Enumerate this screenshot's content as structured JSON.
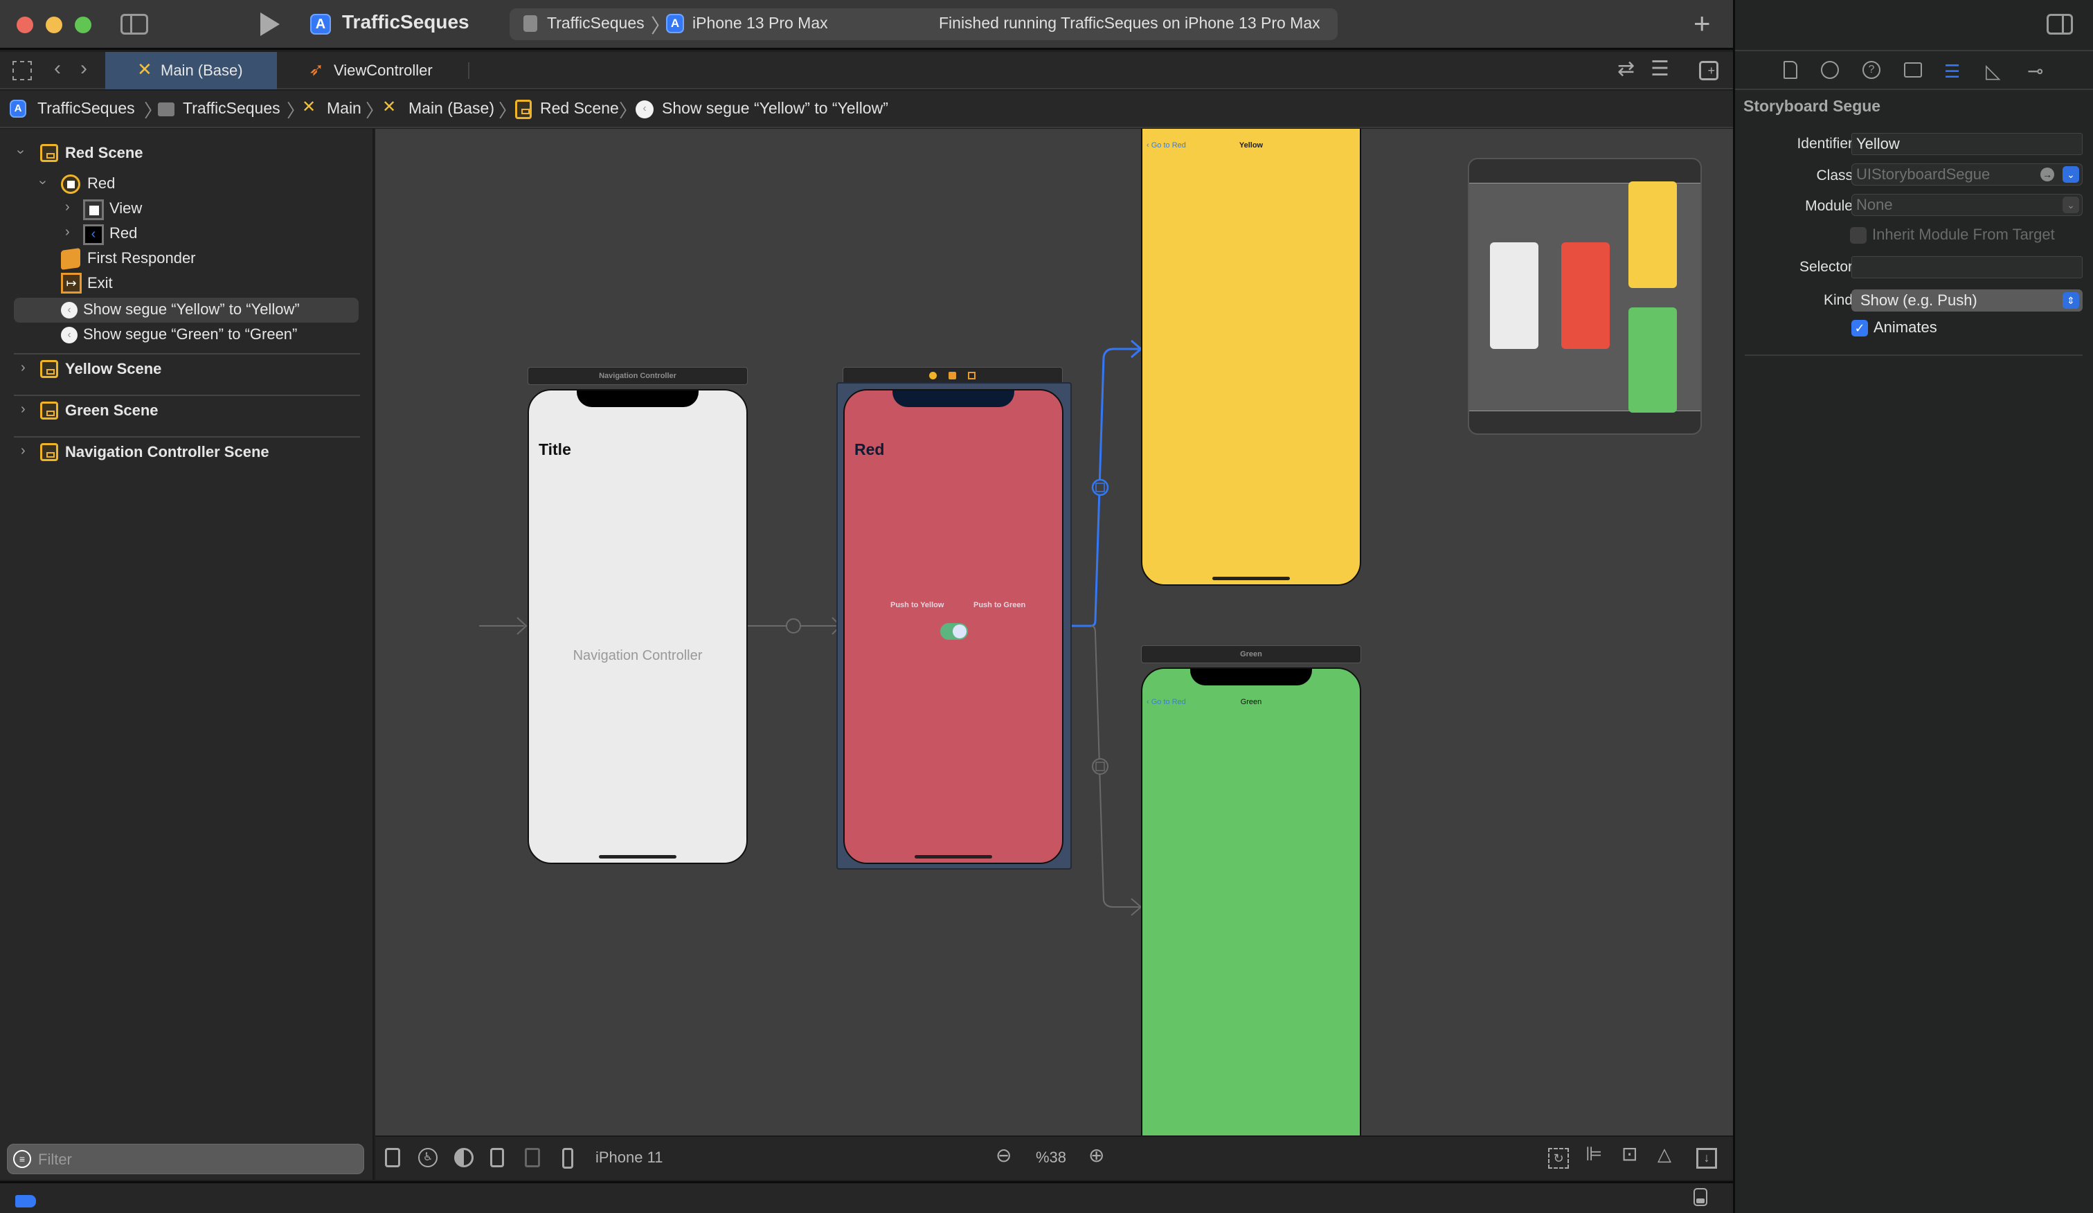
{
  "window": {
    "project_name": "TrafficSeques",
    "scheme": "TrafficSeques",
    "device": "iPhone 13 Pro Max",
    "status": "Finished running TrafficSeques on iPhone 13 Pro Max",
    "add_label": "+"
  },
  "tabs": [
    {
      "label": "Main (Base)",
      "active": true,
      "icon": "storyboard-icon"
    },
    {
      "label": "ViewController",
      "active": false,
      "icon": "swift-icon"
    }
  ],
  "breadcrumb": [
    {
      "label": "TrafficSeques",
      "icon": "app-icon"
    },
    {
      "label": "TrafficSeques",
      "icon": "folder-icon"
    },
    {
      "label": "Main",
      "icon": "storyboard-icon"
    },
    {
      "label": "Main (Base)",
      "icon": "storyboard-icon"
    },
    {
      "label": "Red Scene",
      "icon": "scene-icon"
    },
    {
      "label": "Show segue “Yellow” to “Yellow”",
      "icon": "segue-icon"
    }
  ],
  "navigator": {
    "red_scene": "Red Scene",
    "red_vc": "Red",
    "view": "View",
    "nav_item": "Red",
    "first_responder": "First Responder",
    "exit": "Exit",
    "segue_yellow": "Show segue “Yellow” to “Yellow”",
    "segue_green": "Show segue “Green” to “Green”",
    "yellow_scene": "Yellow Scene",
    "green_scene": "Green Scene",
    "nav_scene": "Navigation Controller Scene",
    "filter_placeholder": "Filter"
  },
  "canvas": {
    "nav_controller": {
      "bar_title": "Navigation Controller",
      "large_title": "Title",
      "center_label": "Navigation Controller",
      "color": "#ebebeb"
    },
    "red": {
      "large_title": "Red",
      "button_yellow": "Push to Yellow",
      "button_green": "Push to Green",
      "switch_on": true,
      "color": "#c75562"
    },
    "yellow": {
      "back_label": "Go to Red",
      "title": "Yellow",
      "color": "#f7cd46"
    },
    "green": {
      "bar_title": "Green",
      "back_label": "Go to Red",
      "title": "Green",
      "color": "#64c466"
    }
  },
  "canvas_toolbar": {
    "device": "iPhone 11",
    "zoom": "%38"
  },
  "inspector": {
    "section_title": "Storyboard Segue",
    "identifier_label": "Identifier",
    "identifier_value": "Yellow",
    "class_label": "Class",
    "class_placeholder": "UIStoryboardSegue",
    "module_label": "Module",
    "module_placeholder": "None",
    "inherit_label": "Inherit Module From Target",
    "inherit_checked": false,
    "selector_label": "Selector",
    "selector_value": "",
    "kind_label": "Kind",
    "kind_value": "Show (e.g. Push)",
    "animates_label": "Animates",
    "animates_checked": true
  },
  "colors": {
    "accent": "#3478f6",
    "selection": "#3b5170"
  }
}
